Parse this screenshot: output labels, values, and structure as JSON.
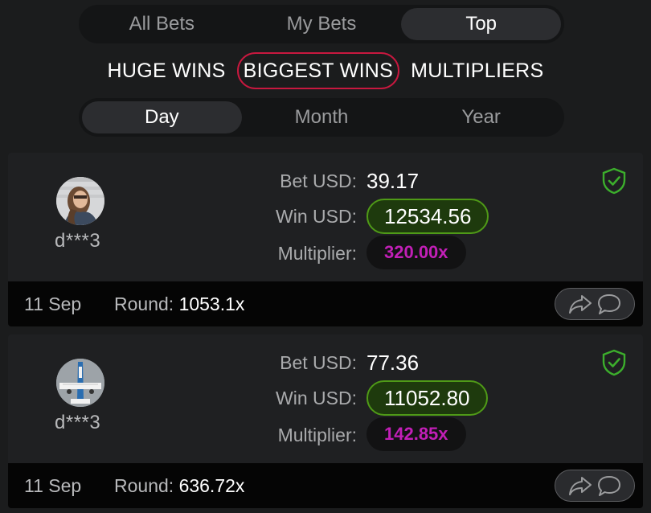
{
  "tabs": [
    {
      "label": "All Bets",
      "active": false
    },
    {
      "label": "My Bets",
      "active": false
    },
    {
      "label": "Top",
      "active": true
    }
  ],
  "categories": [
    {
      "label": "HUGE WINS",
      "active": false
    },
    {
      "label": "BIGGEST WINS",
      "active": true
    },
    {
      "label": "MULTIPLIERS",
      "active": false
    }
  ],
  "periods": [
    {
      "label": "Day",
      "active": true
    },
    {
      "label": "Month",
      "active": false
    },
    {
      "label": "Year",
      "active": false
    }
  ],
  "labels": {
    "bet": "Bet USD:",
    "win": "Win USD:",
    "multiplier": "Multiplier:",
    "round": "Round:"
  },
  "colors": {
    "accent_active_outline": "#c8183f",
    "win_pill_border": "#4f9a17",
    "multiplier_text": "#c21fb7",
    "verified_icon": "#3cae2c"
  },
  "bets": [
    {
      "username": "d***3",
      "avatar_icon": "avatar-woman-photo",
      "bet": "39.17",
      "win": "12534.56",
      "multiplier": "320.00x",
      "date": "11 Sep",
      "round": "1053.1x"
    },
    {
      "username": "d***3",
      "avatar_icon": "avatar-airplane-photo",
      "bet": "77.36",
      "win": "11052.80",
      "multiplier": "142.85x",
      "date": "11 Sep",
      "round": "636.72x"
    }
  ]
}
